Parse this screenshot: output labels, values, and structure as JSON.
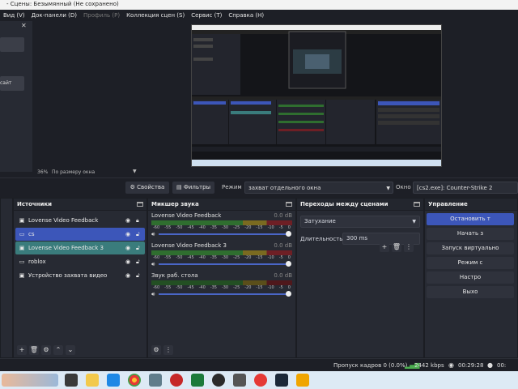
{
  "window": {
    "title": "- Сцены: Безымянный (Не сохранено)"
  },
  "menu": [
    {
      "label": "Вид (V)",
      "disabled": false
    },
    {
      "label": "Док-панели (D)",
      "disabled": false
    },
    {
      "label": "Профиль (P)",
      "disabled": true
    },
    {
      "label": "Коллекция сцен (S)",
      "disabled": false
    },
    {
      "label": "Сервис (T)",
      "disabled": false
    },
    {
      "label": "Справка (H)",
      "disabled": false
    }
  ],
  "left_dock": {
    "item_label": "сайт"
  },
  "preview": {
    "zoom": "36%",
    "zoom_mode": "По размеру окна"
  },
  "context_bar": {
    "properties_label": "Свойства",
    "filters_label": "Фильтры",
    "mode_label": "Режим",
    "mode_value": "захват отдельного окна",
    "window_label": "Окно",
    "window_value": "[cs2.exe]: Counter-Strike 2"
  },
  "sources": {
    "title": "Источники",
    "items": [
      {
        "label": "Lovense Video Feedback",
        "icon": "camera-icon",
        "state": ""
      },
      {
        "label": "cs",
        "icon": "game-capture-icon",
        "state": "selected"
      },
      {
        "label": "Lovense Video Feedback 3",
        "icon": "camera-icon",
        "state": "selected-alt"
      },
      {
        "label": "roblox",
        "icon": "game-capture-icon",
        "state": ""
      },
      {
        "label": "Устройство захвата видео",
        "icon": "camera-icon",
        "state": ""
      }
    ]
  },
  "mixer": {
    "title": "Микшер звука",
    "tracks": [
      {
        "name": "Lovense Video Feedback",
        "db": "0.0 dB",
        "active": true
      },
      {
        "name": "Lovense Video Feedback 3",
        "db": "0.0 dB",
        "active": true
      },
      {
        "name": "Звук раб. стола",
        "db": "0.0 dB",
        "active": false
      }
    ],
    "ticks": [
      "-60",
      "-55",
      "-50",
      "-45",
      "-40",
      "-35",
      "-30",
      "-25",
      "-20",
      "-15",
      "-10",
      "-5",
      "0"
    ]
  },
  "transitions": {
    "title": "Переходы между сценами",
    "selected": "Затухание",
    "duration_label": "Длительность",
    "duration_value": "300 ms"
  },
  "controls": {
    "title": "Управление",
    "buttons": [
      "Остановить т",
      "Начать з",
      "Запуск виртуально",
      "Режим с",
      "Настро",
      "Выхо"
    ]
  },
  "status": {
    "dropped_frames": "Пропуск кадров 0 (0.0%)",
    "bitrate": "2442 kbps",
    "stream_time": "00:29:28",
    "rec_time": "00:"
  },
  "colors": {
    "accent": "#3c56b9",
    "teal_select": "#3a7c7c",
    "bg": "#1d1f26",
    "panel": "#272a33"
  }
}
